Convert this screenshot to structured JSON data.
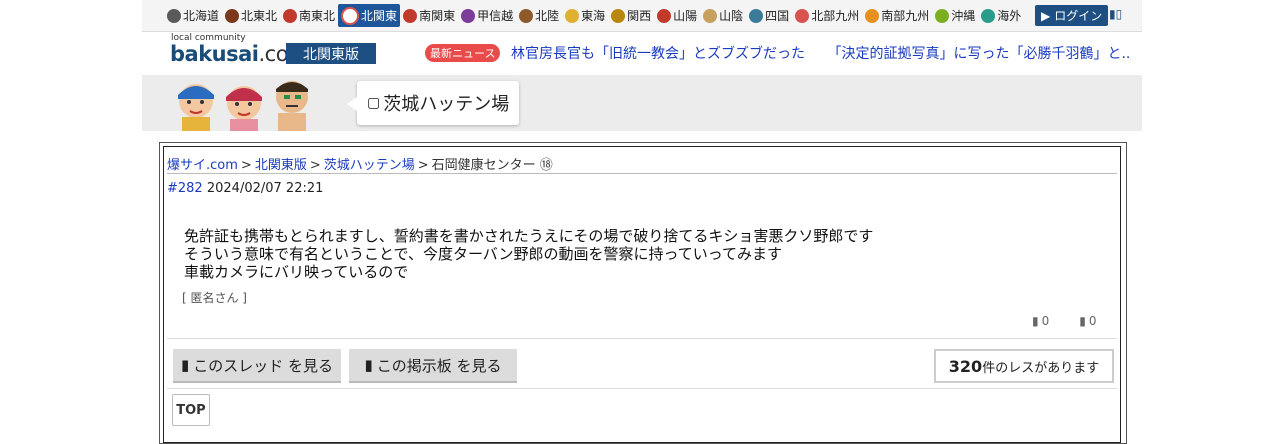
{
  "regions": [
    {
      "label": "北海道",
      "color": "#5a5a5a"
    },
    {
      "label": "北東北",
      "color": "#7a3a1a"
    },
    {
      "label": "南東北",
      "color": "#c0392b"
    },
    {
      "label": "北関東",
      "color": "#d9534f",
      "active": true
    },
    {
      "label": "南関東",
      "color": "#c0392b"
    },
    {
      "label": "甲信越",
      "color": "#7d3c98"
    },
    {
      "label": "北陸",
      "color": "#8e5a2a"
    },
    {
      "label": "東海",
      "color": "#e0b030"
    },
    {
      "label": "関西",
      "color": "#b8860b"
    },
    {
      "label": "山陽",
      "color": "#c0392b"
    },
    {
      "label": "山陰",
      "color": "#c8a060"
    },
    {
      "label": "四国",
      "color": "#3c7a9a"
    },
    {
      "label": "北部九州",
      "color": "#d9534f"
    },
    {
      "label": "南部九州",
      "color": "#e69020"
    },
    {
      "label": "沖縄",
      "color": "#7ab020"
    },
    {
      "label": "海外",
      "color": "#2a9a8a"
    }
  ],
  "header": {
    "login_label": "ログイン",
    "logo_sub": "local community",
    "logo_main": "bakusai",
    "logo_tld": ".com",
    "edition": "北関東版",
    "news_badge": "最新ニュース",
    "news_items": [
      "林官房長官も「旧統一教会」とズブズブだった",
      "「決定的証拠写真」に写った「必勝千羽鶴」と..."
    ]
  },
  "board": {
    "title": "茨城ハッテン場"
  },
  "breadcrumb": {
    "site": "爆サイ.com",
    "edition": "北関東版",
    "board": "茨城ハッテン場",
    "thread": "石岡健康センター ⑱",
    "sep": ">"
  },
  "post": {
    "number": "#282",
    "datetime": "2024/02/07 22:21",
    "lines": [
      "免許証も携帯もとられますし、誓約書を書かされたうえにその場で破り捨てるキショ害悪クソ野郎です",
      "そういう意味で有名ということで、今度ターバン野郎の動画を警察に持っていってみます",
      "車載カメラにバリ映っているので"
    ],
    "author": "[ 匿名さん ]",
    "good_count": "0",
    "bad_count": "0"
  },
  "actions": {
    "view_thread": "このスレッド を見る",
    "view_board": "この掲示板 を見る",
    "res_count": "320",
    "res_suffix": "件のレスがあります",
    "top": "TOP"
  }
}
